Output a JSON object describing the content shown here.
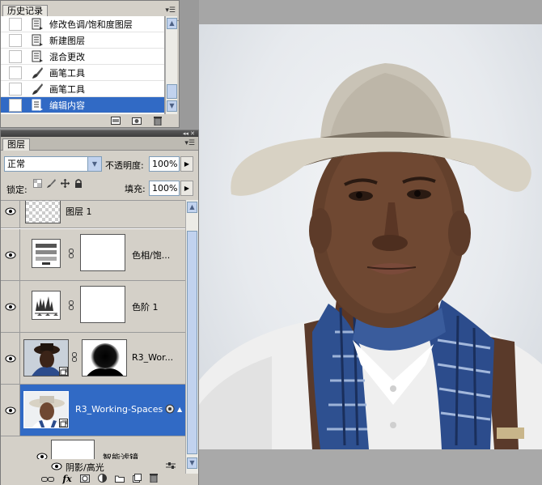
{
  "history": {
    "tab_label": "历史记录",
    "items": [
      {
        "label": "修改色调/饱和度图层",
        "icon": "history-state-icon",
        "selected": false
      },
      {
        "label": "新建图层",
        "icon": "history-state-icon",
        "selected": false
      },
      {
        "label": "混合更改",
        "icon": "history-state-icon",
        "selected": false
      },
      {
        "label": "画笔工具",
        "icon": "brush-icon",
        "selected": false
      },
      {
        "label": "画笔工具",
        "icon": "brush-icon",
        "selected": false
      },
      {
        "label": "编辑内容",
        "icon": "history-state-icon",
        "selected": true
      }
    ]
  },
  "layers": {
    "tab_label": "图层",
    "blend_mode": "正常",
    "opacity_label": "不透明度:",
    "opacity_value": "100%",
    "lock_label": "锁定:",
    "fill_label": "填充:",
    "fill_value": "100%",
    "items": [
      {
        "name": "图层 1",
        "kind": "pixel",
        "selected": false
      },
      {
        "name": "色相/饱...",
        "kind": "hue-saturation",
        "selected": false
      },
      {
        "name": "色阶 1",
        "kind": "levels",
        "selected": false
      },
      {
        "name": "R3_Wor...",
        "kind": "smart-object-masked",
        "selected": false
      },
      {
        "name": "R3_Working-Spaces",
        "kind": "smart-object",
        "selected": true
      }
    ],
    "smart_filters_label": "智能滤镜",
    "filter_effect_label": "阴影/高光"
  },
  "colors": {
    "selection": "#316ac5",
    "panel_bg": "#d4d0c8",
    "workspace": "#a6a6a6"
  }
}
